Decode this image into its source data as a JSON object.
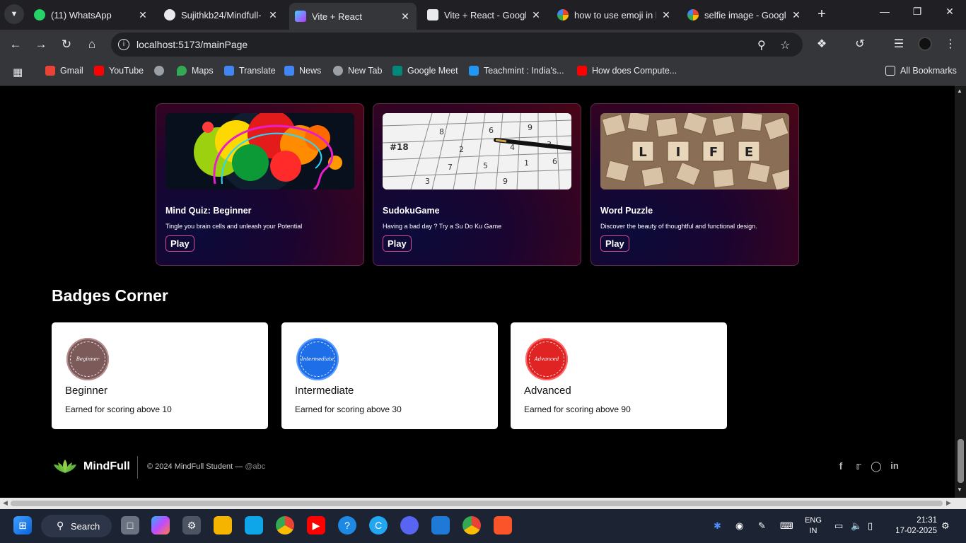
{
  "tabs": [
    {
      "title": "(11) WhatsApp",
      "favicon": "whatsapp-icon",
      "color": "#25d366"
    },
    {
      "title": "Sujithkb24/Mindfull-",
      "favicon": "github-icon",
      "color": "#e8eaed"
    },
    {
      "title": "Vite + React",
      "favicon": "vite-icon",
      "color": "#9b6bff",
      "active": true
    },
    {
      "title": "Vite + React - Google",
      "favicon": "docs-icon",
      "color": "#e8eaed"
    },
    {
      "title": "how to use emoji in l",
      "favicon": "google-icon",
      "color": "#ffffff"
    },
    {
      "title": "selfie image - Google",
      "favicon": "google-icon",
      "color": "#ffffff"
    }
  ],
  "address": {
    "url": "localhost:5173/mainPage"
  },
  "bookmarks": [
    {
      "label": "Gmail",
      "icon": "gmail-icon",
      "color": "#ea4335"
    },
    {
      "label": "YouTube",
      "icon": "youtube-icon",
      "color": "#ff0000"
    },
    {
      "label": "",
      "icon": "globe-icon",
      "color": "#9aa0a6"
    },
    {
      "label": "Maps",
      "icon": "maps-icon",
      "color": "#34a853"
    },
    {
      "label": "Translate",
      "icon": "translate-icon",
      "color": "#4285f4"
    },
    {
      "label": "News",
      "icon": "news-icon",
      "color": "#4285f4"
    },
    {
      "label": "New Tab",
      "icon": "globe-icon",
      "color": "#9aa0a6"
    },
    {
      "label": "Google Meet",
      "icon": "meet-icon",
      "color": "#00897b"
    },
    {
      "label": "Teachmint : India's...",
      "icon": "teachmint-icon",
      "color": "#2196f3"
    },
    {
      "label": "How does Compute...",
      "icon": "youtube-icon",
      "color": "#ff0000"
    },
    {
      "label": "All Bookmarks",
      "icon": "folder-icon",
      "color": "#e8eaed"
    }
  ],
  "games": [
    {
      "title": "Mind Quiz: Beginner",
      "desc": "Tingle you brain cells and unleash your Potential",
      "play": "Play"
    },
    {
      "title": "SudokuGame",
      "desc": "Having a bad day ? Try a Su Do Ku Game",
      "play": "Play",
      "img_text": "#18"
    },
    {
      "title": "Word Puzzle",
      "desc": "Discover the beauty of thoughtful and functional design.",
      "play": "Play",
      "tiles": [
        "L",
        "I",
        "F",
        "E"
      ]
    }
  ],
  "badges_title": "Badges Corner",
  "badges": [
    {
      "name": "Beginner",
      "desc": "Earned for scoring above 10",
      "medal_text": "Beginner",
      "color": "#7d5a5a"
    },
    {
      "name": "Intermediate",
      "desc": "Earned for scoring above 30",
      "medal_text": "Intermediate",
      "color": "#1e6ee8"
    },
    {
      "name": "Advanced",
      "desc": "Earned for scoring above 90",
      "medal_text": "Advanced",
      "color": "#e02424"
    }
  ],
  "footer": {
    "brand": "MindFull",
    "copyright": "© 2024 MindFull Student —",
    "handle": "@abc"
  },
  "taskbar": {
    "search": "Search",
    "lang": "ENG",
    "region": "IN",
    "time": "21:31",
    "date": "17-02-2025"
  }
}
